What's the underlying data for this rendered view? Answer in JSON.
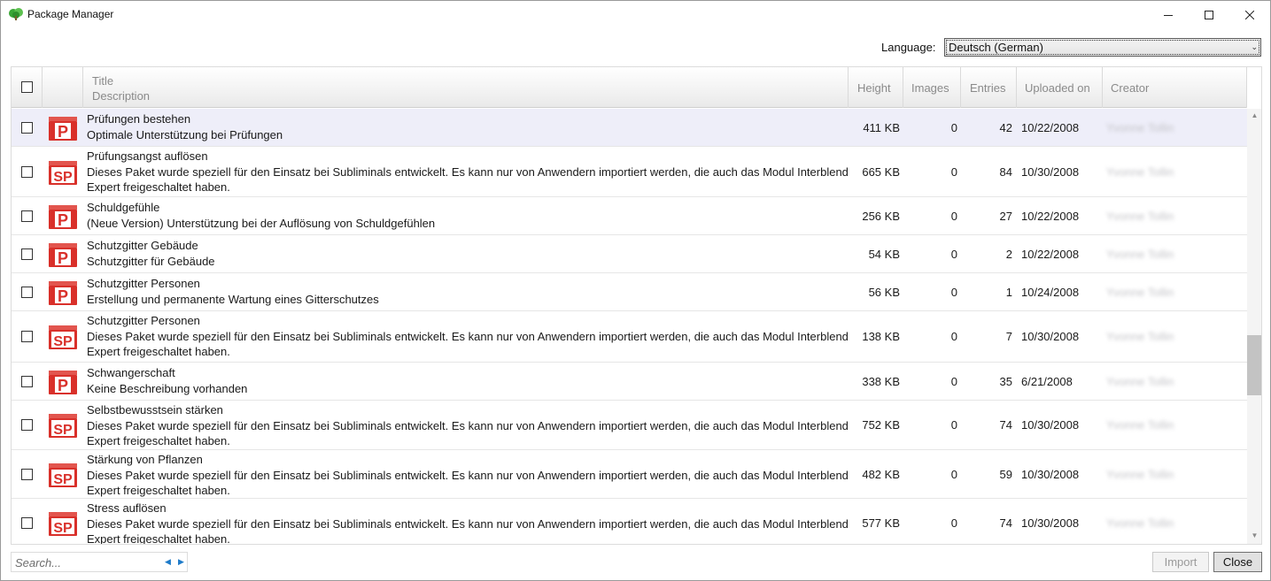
{
  "window": {
    "title": "Package Manager",
    "controls": [
      "minimize-icon",
      "maximize-icon",
      "close-icon"
    ]
  },
  "language": {
    "label": "Language:",
    "selected": "Deutsch (German)"
  },
  "table": {
    "columns": {
      "title": "Title",
      "description": "Description",
      "height": "Height",
      "images": "Images",
      "entries": "Entries",
      "uploaded": "Uploaded on",
      "creator": "Creator"
    },
    "rows": [
      {
        "icon": "P",
        "title": "Prüfungen bestehen",
        "description": "Optimale Unterstützung bei Prüfungen",
        "height": "411 KB",
        "images": "0",
        "entries": "42",
        "uploaded": "10/22/2008",
        "creator": "Yvonne Tollin"
      },
      {
        "icon": "SP",
        "title": "Prüfungsangst auflösen",
        "description": "Dieses Paket wurde speziell für den Einsatz bei Subliminals entwickelt. Es kann nur von Anwendern importiert werden, die auch das Modul Interblend Expert freigeschaltet haben.",
        "height": "665 KB",
        "images": "0",
        "entries": "84",
        "uploaded": "10/30/2008",
        "creator": "Yvonne Tollin"
      },
      {
        "icon": "P",
        "title": "Schuldgefühle",
        "description": "(Neue Version) Unterstützung bei der Auflösung von Schuldgefühlen",
        "height": "256 KB",
        "images": "0",
        "entries": "27",
        "uploaded": "10/22/2008",
        "creator": "Yvonne Tollin"
      },
      {
        "icon": "P",
        "title": "Schutzgitter Gebäude",
        "description": "Schutzgitter für Gebäude",
        "height": "54 KB",
        "images": "0",
        "entries": "2",
        "uploaded": "10/22/2008",
        "creator": "Yvonne Tollin"
      },
      {
        "icon": "P",
        "title": "Schutzgitter Personen",
        "description": "Erstellung und permanente Wartung eines Gitterschutzes",
        "height": "56 KB",
        "images": "0",
        "entries": "1",
        "uploaded": "10/24/2008",
        "creator": "Yvonne Tollin"
      },
      {
        "icon": "SP",
        "title": "Schutzgitter Personen",
        "description": "Dieses Paket wurde speziell für den Einsatz bei Subliminals entwickelt. Es kann nur von Anwendern importiert werden, die auch das Modul Interblend Expert freigeschaltet haben.",
        "height": "138 KB",
        "images": "0",
        "entries": "7",
        "uploaded": "10/30/2008",
        "creator": "Yvonne Tollin"
      },
      {
        "icon": "P",
        "title": "Schwangerschaft",
        "description": "Keine Beschreibung vorhanden",
        "height": "338 KB",
        "images": "0",
        "entries": "35",
        "uploaded": "6/21/2008",
        "creator": "Yvonne Tollin"
      },
      {
        "icon": "SP",
        "title": "Selbstbewusstsein stärken",
        "description": "Dieses Paket wurde speziell für den Einsatz bei Subliminals entwickelt. Es kann nur von Anwendern importiert werden, die auch das Modul Interblend Expert freigeschaltet haben.",
        "height": "752 KB",
        "images": "0",
        "entries": "74",
        "uploaded": "10/30/2008",
        "creator": "Yvonne Tollin"
      },
      {
        "icon": "SP",
        "title": "Stärkung von Pflanzen",
        "description": "Dieses Paket wurde speziell für den Einsatz bei Subliminals entwickelt. Es kann nur von Anwendern importiert werden, die auch das Modul Interblend Expert freigeschaltet haben.",
        "height": "482 KB",
        "images": "0",
        "entries": "59",
        "uploaded": "10/30/2008",
        "creator": "Yvonne Tollin"
      },
      {
        "icon": "SP",
        "title": "Stress auflösen",
        "description": "Dieses Paket wurde speziell für den Einsatz bei Subliminals entwickelt. Es kann nur von Anwendern importiert werden, die auch das Modul Interblend Expert freigeschaltet haben.",
        "height": "577 KB",
        "images": "0",
        "entries": "74",
        "uploaded": "10/30/2008",
        "creator": "Yvonne Tollin"
      }
    ]
  },
  "search": {
    "placeholder": "Search..."
  },
  "buttons": {
    "import": "Import",
    "close": "Close"
  },
  "colors": {
    "accent": "#1e7bc9",
    "icon_red": "#d9302a",
    "selected_row": "#eeeef9"
  }
}
